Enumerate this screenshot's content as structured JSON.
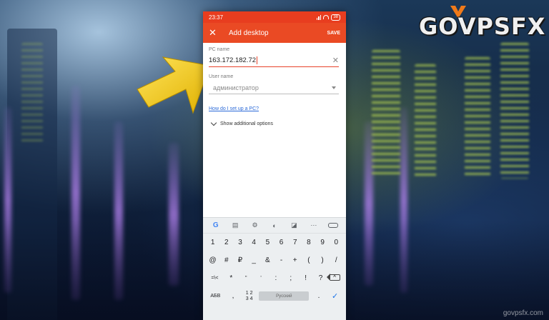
{
  "status_bar": {
    "time": "23:37",
    "battery": "38"
  },
  "app_bar": {
    "title": "Add desktop",
    "save_label": "SAVE",
    "close_icon": "close-icon"
  },
  "form": {
    "pc_name_label": "PC name",
    "pc_name_value": "163.172.182.72",
    "user_name_label": "User name",
    "user_name_value": "администратор",
    "help_link": "How do I set up a PC?",
    "additional_options": "Show additional options"
  },
  "keyboard": {
    "toolbar_icons": [
      "google-icon",
      "clipboard-icon",
      "settings-icon",
      "theme-icon",
      "sticker-icon",
      "more-icon",
      "mic-icon"
    ],
    "row1": [
      "1",
      "2",
      "3",
      "4",
      "5",
      "6",
      "7",
      "8",
      "9",
      "0"
    ],
    "row2": [
      "@",
      "#",
      "₽",
      "_",
      "&",
      "-",
      "+",
      "(",
      ")",
      "/"
    ],
    "row3": [
      "=\\<",
      "*",
      "\"",
      "'",
      ":",
      ";",
      "!",
      "?"
    ],
    "row4": {
      "abc": "АБВ",
      "comma": ",",
      "numpad_top": "1 2",
      "numpad_bottom": "3 4",
      "space": "Русский",
      "period": "."
    }
  },
  "logo": {
    "text": "GOVPSFX"
  },
  "watermark": "govpsfx.com",
  "colors": {
    "accent": "#ea4a24",
    "status_bar": "#e83d1f",
    "link": "#2d6bd8",
    "arrow": "#f5d020"
  }
}
